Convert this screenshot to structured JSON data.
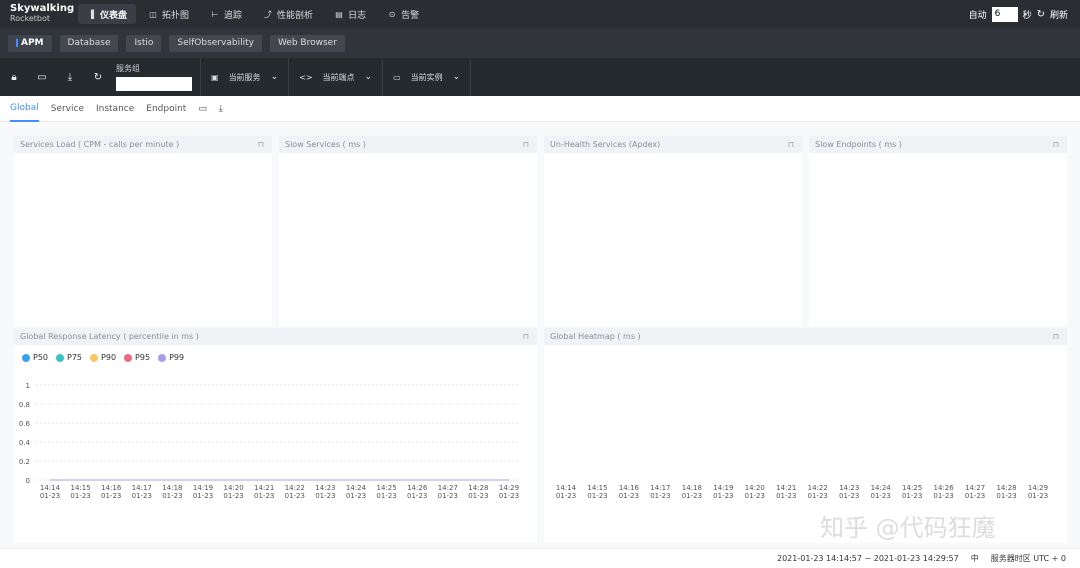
{
  "nav": {
    "logo_line1": "Skywalking",
    "logo_line2": "Rocketbot",
    "items": [
      {
        "label": "仪表盘",
        "icon": "bar-chart-icon",
        "glyph": "▐"
      },
      {
        "label": "拓扑图",
        "icon": "topology-icon",
        "glyph": "◫"
      },
      {
        "label": "追踪",
        "icon": "trace-icon",
        "glyph": "⊢"
      },
      {
        "label": "性能剖析",
        "icon": "profile-icon",
        "glyph": "⤴"
      },
      {
        "label": "日志",
        "icon": "log-icon",
        "glyph": "▤"
      },
      {
        "label": "告警",
        "icon": "alarm-icon",
        "glyph": "⊙"
      }
    ],
    "auto_label": "自动",
    "auto_value": "6",
    "seconds_label": "秒",
    "refresh_label": "刷新"
  },
  "tabs": [
    "APM",
    "Database",
    "Istio",
    "SelfObservability",
    "Web Browser"
  ],
  "toolbar": {
    "service_group_label": "服务组",
    "current_service": "当前服务",
    "current_endpoint": "当前端点",
    "current_instance": "当前实例"
  },
  "subtabs": [
    "Global",
    "Service",
    "Instance",
    "Endpoint"
  ],
  "panels": {
    "services_load": "Services Load ( CPM - calls per minute )",
    "slow_services": "Slow Services ( ms )",
    "unhealth_services": "Un-Health Services (Apdex)",
    "slow_endpoints": "Slow Endpoints ( ms )",
    "response_latency": "Global Response Latency ( percentile in ms )",
    "heatmap": "Global Heatmap ( ms )"
  },
  "chart_data": [
    {
      "type": "line",
      "title": "Global Response Latency ( percentile in ms )",
      "x": [
        "14:14\n01-23",
        "14:15\n01-23",
        "14:16\n01-23",
        "14:17\n01-23",
        "14:18\n01-23",
        "14:19\n01-23",
        "14:20\n01-23",
        "14:21\n01-23",
        "14:22\n01-23",
        "14:23\n01-23",
        "14:24\n01-23",
        "14:25\n01-23",
        "14:26\n01-23",
        "14:27\n01-23",
        "14:28\n01-23",
        "14:29\n01-23"
      ],
      "y_ticks": [
        "1",
        "0.8",
        "0.6",
        "0.4",
        "0.2",
        "0"
      ],
      "ylim": [
        0,
        1
      ],
      "grid": true,
      "legend_position": "top-left",
      "series": [
        {
          "name": "P50",
          "color": "#3aa0e9",
          "values": [
            0,
            0,
            0,
            0,
            0,
            0,
            0,
            0,
            0,
            0,
            0,
            0,
            0,
            0,
            0,
            0
          ]
        },
        {
          "name": "P75",
          "color": "#3cc4c4",
          "values": [
            0,
            0,
            0,
            0,
            0,
            0,
            0,
            0,
            0,
            0,
            0,
            0,
            0,
            0,
            0,
            0
          ]
        },
        {
          "name": "P90",
          "color": "#f6c85f",
          "values": [
            0,
            0,
            0,
            0,
            0,
            0,
            0,
            0,
            0,
            0,
            0,
            0,
            0,
            0,
            0,
            0
          ]
        },
        {
          "name": "P95",
          "color": "#f06880",
          "values": [
            0,
            0,
            0,
            0,
            0,
            0,
            0,
            0,
            0,
            0,
            0,
            0,
            0,
            0,
            0,
            0
          ]
        },
        {
          "name": "P99",
          "color": "#a69ee8",
          "values": [
            0,
            0,
            0,
            0,
            0,
            0,
            0,
            0,
            0,
            0,
            0,
            0,
            0,
            0,
            0,
            0
          ]
        }
      ]
    },
    {
      "type": "heatmap",
      "title": "Global Heatmap ( ms )",
      "x": [
        "14:14\n01-23",
        "14:15\n01-23",
        "14:16\n01-23",
        "14:17\n01-23",
        "14:18\n01-23",
        "14:19\n01-23",
        "14:20\n01-23",
        "14:21\n01-23",
        "14:22\n01-23",
        "14:23\n01-23",
        "14:24\n01-23",
        "14:25\n01-23",
        "14:26\n01-23",
        "14:27\n01-23",
        "14:28\n01-23",
        "14:29\n01-23"
      ]
    }
  ],
  "footer": {
    "time_range": "2021-01-23 14:14:57 ~ 2021-01-23 14:29:57",
    "lang": "中",
    "timezone": "服务器时区 UTC + 0"
  },
  "watermark": "知乎 @代码狂魔"
}
